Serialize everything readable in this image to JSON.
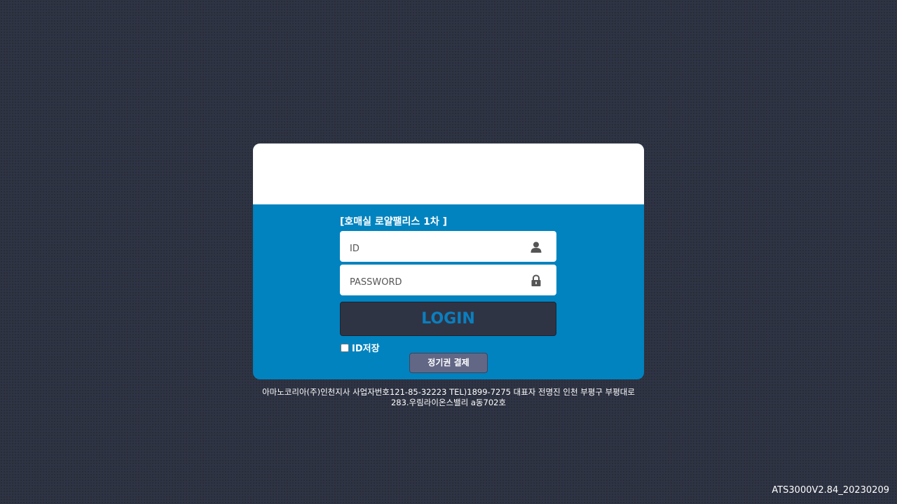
{
  "login": {
    "site_name": "[호매실 로얄팰리스 1차 ]",
    "id_placeholder": "ID",
    "password_placeholder": "PASSWORD",
    "login_label": "LOGIN",
    "remember_label": "ID저장",
    "remember_checked": false,
    "pay_label": "정기권 결제"
  },
  "footer": {
    "company_info_line1": "아마노코리아(주)인천지사 사업자번호121-85-32223 TEL)1899-7275 대표자 전명진 인천 부평구 부평대로",
    "company_info_line2": "283.우림라이온스밸리 a동702호"
  },
  "version": "ATS3000V2.84_20230209",
  "icons": {
    "id_field": "user-icon",
    "password_field": "lock-icon"
  },
  "colors": {
    "background": "#2f3444",
    "card_accent": "#0083bf",
    "login_button_bg": "#2f3444",
    "login_button_text": "#0a7fc0",
    "pay_button_bg": "#626786"
  }
}
